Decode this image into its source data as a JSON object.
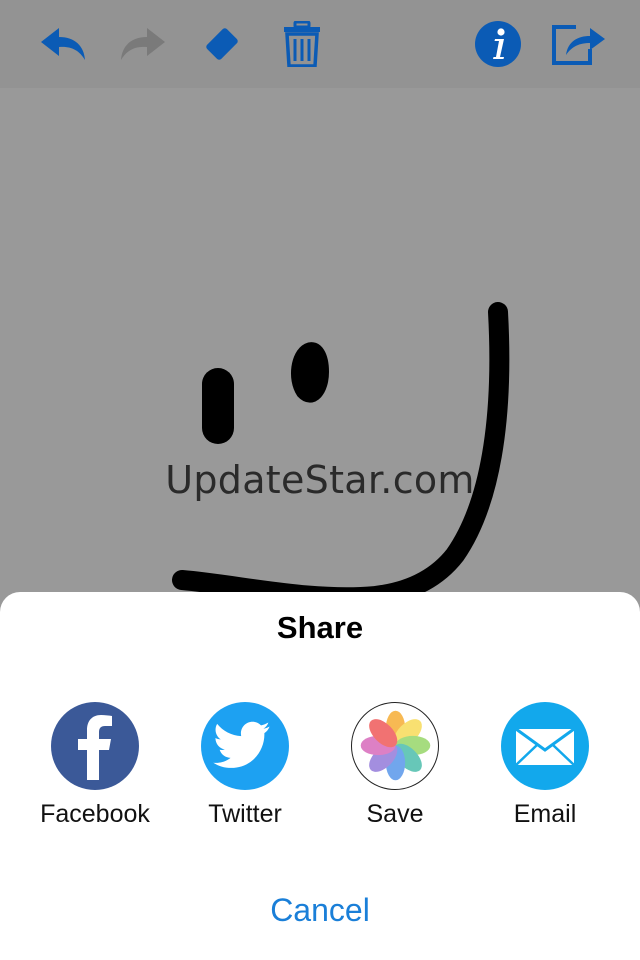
{
  "toolbar": {
    "buttons": [
      {
        "name": "undo",
        "icon": "undo-arrow-icon",
        "enabled": true
      },
      {
        "name": "redo",
        "icon": "redo-arrow-icon",
        "enabled": false
      },
      {
        "name": "eraser",
        "icon": "eraser-icon",
        "enabled": true
      },
      {
        "name": "clear",
        "icon": "trash-icon",
        "enabled": true
      },
      {
        "name": "info",
        "icon": "info-icon",
        "enabled": true
      },
      {
        "name": "share",
        "icon": "share-icon",
        "enabled": true
      }
    ],
    "accent_color": "#0b5bb5",
    "disabled_color": "#7a7a7a"
  },
  "canvas": {
    "watermark": "UpdateStar.com",
    "drawing": "hand-drawn-smiley"
  },
  "share_sheet": {
    "title": "Share",
    "items": [
      {
        "label": "Facebook",
        "icon": "facebook-icon",
        "color": "#3b5998"
      },
      {
        "label": "Twitter",
        "icon": "twitter-icon",
        "color": "#1da1f2"
      },
      {
        "label": "Save",
        "icon": "photos-icon",
        "color": "#ffffff"
      },
      {
        "label": "Email",
        "icon": "mail-icon",
        "color": "#12a8ec"
      }
    ],
    "cancel_label": "Cancel"
  }
}
